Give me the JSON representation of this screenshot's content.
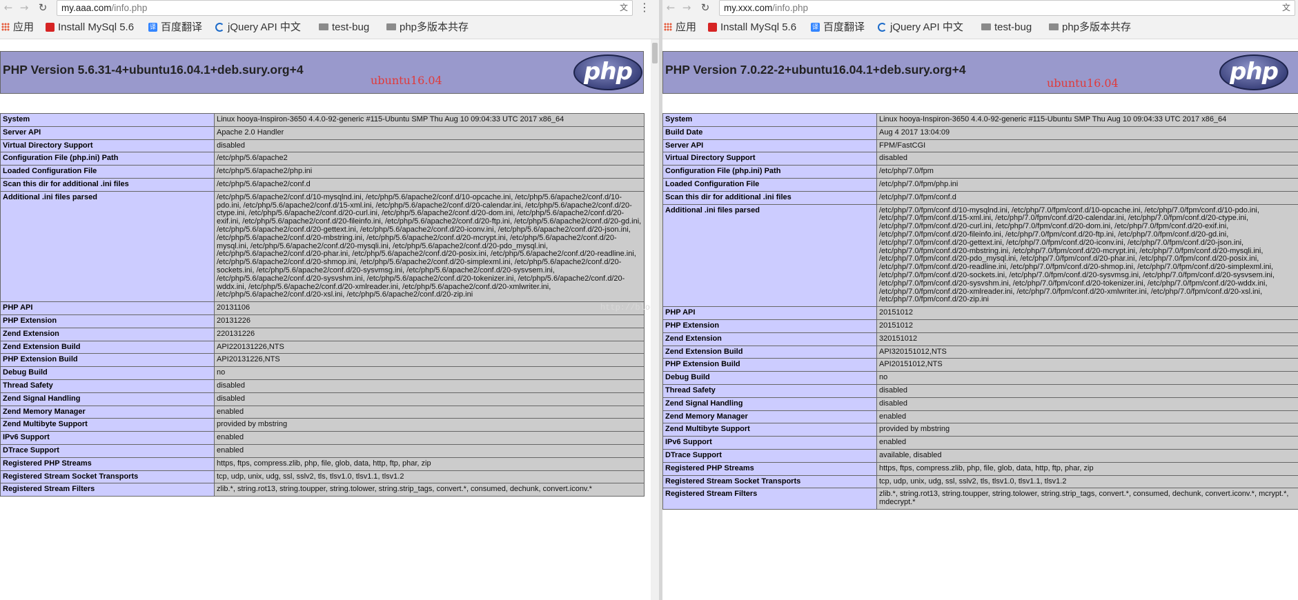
{
  "browser": {
    "left_url_host": "my.aaa.com",
    "left_url_path": "/info.php",
    "right_url_host": "my.xxx.com",
    "right_url_path": "/info.php",
    "translate_icon": "translate-icon",
    "bookmarks": [
      {
        "label": "应用",
        "icon": "apps-icon"
      },
      {
        "label": "Install MySql 5.6",
        "icon": "mysql-icon"
      },
      {
        "label": "百度翻译",
        "icon": "baidu-icon"
      },
      {
        "label": "jQuery API 中文",
        "icon": "jquery-icon"
      },
      {
        "label": "test-bug",
        "icon": "folder-icon"
      },
      {
        "label": "php多版本共存",
        "icon": "folder-icon"
      }
    ]
  },
  "left": {
    "title": "PHP Version 5.6.31-4+ubuntu16.04.1+deb.sury.org+4",
    "note": "ubuntu16.04",
    "logo": "php",
    "rows": [
      {
        "k": "System",
        "v": "Linux hooya-Inspiron-3650 4.4.0-92-generic #115-Ubuntu SMP Thu Aug 10 09:04:33 UTC 2017 x86_64"
      },
      {
        "k": "Server API",
        "v": "Apache 2.0 Handler"
      },
      {
        "k": "Virtual Directory Support",
        "v": "disabled"
      },
      {
        "k": "Configuration File (php.ini) Path",
        "v": "/etc/php/5.6/apache2"
      },
      {
        "k": "Loaded Configuration File",
        "v": "/etc/php/5.6/apache2/php.ini"
      },
      {
        "k": "Scan this dir for additional .ini files",
        "v": "/etc/php/5.6/apache2/conf.d"
      },
      {
        "k": "Additional .ini files parsed",
        "v": "/etc/php/5.6/apache2/conf.d/10-mysqlnd.ini, /etc/php/5.6/apache2/conf.d/10-opcache.ini, /etc/php/5.6/apache2/conf.d/10-pdo.ini, /etc/php/5.6/apache2/conf.d/15-xml.ini, /etc/php/5.6/apache2/conf.d/20-calendar.ini, /etc/php/5.6/apache2/conf.d/20-ctype.ini, /etc/php/5.6/apache2/conf.d/20-curl.ini, /etc/php/5.6/apache2/conf.d/20-dom.ini, /etc/php/5.6/apache2/conf.d/20-exif.ini, /etc/php/5.6/apache2/conf.d/20-fileinfo.ini, /etc/php/5.6/apache2/conf.d/20-ftp.ini, /etc/php/5.6/apache2/conf.d/20-gd.ini, /etc/php/5.6/apache2/conf.d/20-gettext.ini, /etc/php/5.6/apache2/conf.d/20-iconv.ini, /etc/php/5.6/apache2/conf.d/20-json.ini, /etc/php/5.6/apache2/conf.d/20-mbstring.ini, /etc/php/5.6/apache2/conf.d/20-mcrypt.ini, /etc/php/5.6/apache2/conf.d/20-mysql.ini, /etc/php/5.6/apache2/conf.d/20-mysqli.ini, /etc/php/5.6/apache2/conf.d/20-pdo_mysql.ini, /etc/php/5.6/apache2/conf.d/20-phar.ini, /etc/php/5.6/apache2/conf.d/20-posix.ini, /etc/php/5.6/apache2/conf.d/20-readline.ini, /etc/php/5.6/apache2/conf.d/20-shmop.ini, /etc/php/5.6/apache2/conf.d/20-simplexml.ini, /etc/php/5.6/apache2/conf.d/20-sockets.ini, /etc/php/5.6/apache2/conf.d/20-sysvmsg.ini, /etc/php/5.6/apache2/conf.d/20-sysvsem.ini, /etc/php/5.6/apache2/conf.d/20-sysvshm.ini, /etc/php/5.6/apache2/conf.d/20-tokenizer.ini, /etc/php/5.6/apache2/conf.d/20-wddx.ini, /etc/php/5.6/apache2/conf.d/20-xmlreader.ini, /etc/php/5.6/apache2/conf.d/20-xmlwriter.ini, /etc/php/5.6/apache2/conf.d/20-xsl.ini, /etc/php/5.6/apache2/conf.d/20-zip.ini"
      },
      {
        "k": "PHP API",
        "v": "20131106"
      },
      {
        "k": "PHP Extension",
        "v": "20131226"
      },
      {
        "k": "Zend Extension",
        "v": "220131226"
      },
      {
        "k": "Zend Extension Build",
        "v": "API220131226,NTS"
      },
      {
        "k": "PHP Extension Build",
        "v": "API20131226,NTS"
      },
      {
        "k": "Debug Build",
        "v": "no"
      },
      {
        "k": "Thread Safety",
        "v": "disabled"
      },
      {
        "k": "Zend Signal Handling",
        "v": "disabled"
      },
      {
        "k": "Zend Memory Manager",
        "v": "enabled"
      },
      {
        "k": "Zend Multibyte Support",
        "v": "provided by mbstring"
      },
      {
        "k": "IPv6 Support",
        "v": "enabled"
      },
      {
        "k": "DTrace Support",
        "v": "enabled"
      },
      {
        "k": "Registered PHP Streams",
        "v": "https, ftps, compress.zlib, php, file, glob, data, http, ftp, phar, zip"
      },
      {
        "k": "Registered Stream Socket Transports",
        "v": "tcp, udp, unix, udg, ssl, sslv2, tls, tlsv1.0, tlsv1.1, tlsv1.2"
      },
      {
        "k": "Registered Stream Filters",
        "v": "zlib.*, string.rot13, string.toupper, string.tolower, string.strip_tags, convert.*, consumed, dechunk, convert.iconv.*"
      }
    ]
  },
  "right": {
    "title": "PHP Version 7.0.22-2+ubuntu16.04.1+deb.sury.org+4",
    "note": "ubuntu16.04",
    "logo": "php",
    "rows": [
      {
        "k": "System",
        "v": "Linux hooya-Inspiron-3650 4.4.0-92-generic #115-Ubuntu SMP Thu Aug 10 09:04:33 UTC 2017 x86_64"
      },
      {
        "k": "Build Date",
        "v": "Aug 4 2017 13:04:09"
      },
      {
        "k": "Server API",
        "v": "FPM/FastCGI"
      },
      {
        "k": "Virtual Directory Support",
        "v": "disabled"
      },
      {
        "k": "Configuration File (php.ini) Path",
        "v": "/etc/php/7.0/fpm"
      },
      {
        "k": "Loaded Configuration File",
        "v": "/etc/php/7.0/fpm/php.ini"
      },
      {
        "k": "Scan this dir for additional .ini files",
        "v": "/etc/php/7.0/fpm/conf.d"
      },
      {
        "k": "Additional .ini files parsed",
        "v": "/etc/php/7.0/fpm/conf.d/10-mysqlnd.ini, /etc/php/7.0/fpm/conf.d/10-opcache.ini, /etc/php/7.0/fpm/conf.d/10-pdo.ini, /etc/php/7.0/fpm/conf.d/15-xml.ini, /etc/php/7.0/fpm/conf.d/20-calendar.ini, /etc/php/7.0/fpm/conf.d/20-ctype.ini, /etc/php/7.0/fpm/conf.d/20-curl.ini, /etc/php/7.0/fpm/conf.d/20-dom.ini, /etc/php/7.0/fpm/conf.d/20-exif.ini, /etc/php/7.0/fpm/conf.d/20-fileinfo.ini, /etc/php/7.0/fpm/conf.d/20-ftp.ini, /etc/php/7.0/fpm/conf.d/20-gd.ini, /etc/php/7.0/fpm/conf.d/20-gettext.ini, /etc/php/7.0/fpm/conf.d/20-iconv.ini, /etc/php/7.0/fpm/conf.d/20-json.ini, /etc/php/7.0/fpm/conf.d/20-mbstring.ini, /etc/php/7.0/fpm/conf.d/20-mcrypt.ini, /etc/php/7.0/fpm/conf.d/20-mysqli.ini, /etc/php/7.0/fpm/conf.d/20-pdo_mysql.ini, /etc/php/7.0/fpm/conf.d/20-phar.ini, /etc/php/7.0/fpm/conf.d/20-posix.ini, /etc/php/7.0/fpm/conf.d/20-readline.ini, /etc/php/7.0/fpm/conf.d/20-shmop.ini, /etc/php/7.0/fpm/conf.d/20-simplexml.ini, /etc/php/7.0/fpm/conf.d/20-sockets.ini, /etc/php/7.0/fpm/conf.d/20-sysvmsg.ini, /etc/php/7.0/fpm/conf.d/20-sysvsem.ini, /etc/php/7.0/fpm/conf.d/20-sysvshm.ini, /etc/php/7.0/fpm/conf.d/20-tokenizer.ini, /etc/php/7.0/fpm/conf.d/20-wddx.ini, /etc/php/7.0/fpm/conf.d/20-xmlreader.ini, /etc/php/7.0/fpm/conf.d/20-xmlwriter.ini, /etc/php/7.0/fpm/conf.d/20-xsl.ini, /etc/php/7.0/fpm/conf.d/20-zip.ini"
      },
      {
        "k": "PHP API",
        "v": "20151012"
      },
      {
        "k": "PHP Extension",
        "v": "20151012"
      },
      {
        "k": "Zend Extension",
        "v": "320151012"
      },
      {
        "k": "Zend Extension Build",
        "v": "API320151012,NTS"
      },
      {
        "k": "PHP Extension Build",
        "v": "API20151012,NTS"
      },
      {
        "k": "Debug Build",
        "v": "no"
      },
      {
        "k": "Thread Safety",
        "v": "disabled"
      },
      {
        "k": "Zend Signal Handling",
        "v": "disabled"
      },
      {
        "k": "Zend Memory Manager",
        "v": "enabled"
      },
      {
        "k": "Zend Multibyte Support",
        "v": "provided by mbstring"
      },
      {
        "k": "IPv6 Support",
        "v": "enabled"
      },
      {
        "k": "DTrace Support",
        "v": "available, disabled"
      },
      {
        "k": "Registered PHP Streams",
        "v": "https, ftps, compress.zlib, php, file, glob, data, http, ftp, phar, zip"
      },
      {
        "k": "Registered Stream Socket Transports",
        "v": "tcp, udp, unix, udg, ssl, sslv2, tls, tlsv1.0, tlsv1.1, tlsv1.2"
      },
      {
        "k": "Registered Stream Filters",
        "v": "zlib.*, string.rot13, string.toupper, string.tolower, string.strip_tags, convert.*, consumed, dechunk, convert.iconv.*, mcrypt.*, mdecrypt.*"
      }
    ]
  },
  "watermark": "http://blog.csdn.net/zhousmq",
  "colors": {
    "header_bg": "#9999cc",
    "key_bg": "#ccccff",
    "value_bg": "#cccccc",
    "note_color": "#e03a3a"
  }
}
